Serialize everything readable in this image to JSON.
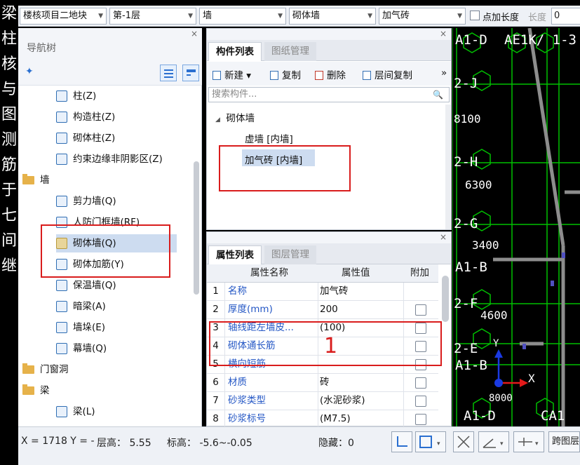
{
  "left_strip": {
    "chars": [
      "梁",
      "柱",
      "核",
      "与",
      "图",
      "测",
      "筋",
      "于",
      "七",
      "间",
      "继"
    ]
  },
  "toolbar": {
    "project": "楼核项目二地块",
    "floor": "第-1层",
    "category": "墙",
    "type": "砌体墙",
    "component": "加气砖",
    "add_length_label": "点加长度",
    "length_label": "长度",
    "length_value": "0"
  },
  "nav": {
    "close": "×",
    "title": "导航树",
    "items": [
      {
        "label": "柱(Z)",
        "kind": "item"
      },
      {
        "label": "构造柱(Z)",
        "kind": "item"
      },
      {
        "label": "砌体柱(Z)",
        "kind": "item"
      },
      {
        "label": "约束边缘非阴影区(Z)",
        "kind": "item"
      },
      {
        "label": "墙",
        "kind": "folder"
      },
      {
        "label": "剪力墙(Q)",
        "kind": "item"
      },
      {
        "label": "人防门框墙(RF)",
        "kind": "item"
      },
      {
        "label": "砌体墙(Q)",
        "kind": "item",
        "selected": true
      },
      {
        "label": "砌体加筋(Y)",
        "kind": "item"
      },
      {
        "label": "保温墙(Q)",
        "kind": "item"
      },
      {
        "label": "暗梁(A)",
        "kind": "item"
      },
      {
        "label": "墙垛(E)",
        "kind": "item"
      },
      {
        "label": "幕墙(Q)",
        "kind": "item"
      },
      {
        "label": "门窗洞",
        "kind": "folder"
      },
      {
        "label": "梁",
        "kind": "folder"
      },
      {
        "label": "梁(L)",
        "kind": "item"
      }
    ]
  },
  "components": {
    "close": "×",
    "tab_active": "构件列表",
    "tab_inactive": "图纸管理",
    "tools": {
      "new": "新建",
      "copy": "复制",
      "delete": "删除",
      "floor_copy": "层间复制",
      "more": "»"
    },
    "search_placeholder": "搜索构件...",
    "group": "砌体墙",
    "items": [
      "虚墙 [内墙]",
      "加气砖 [内墙]"
    ]
  },
  "properties": {
    "close": "×",
    "tab_active": "属性列表",
    "tab_inactive": "图层管理",
    "headers": [
      "属性名称",
      "属性值",
      "附加"
    ],
    "rows": [
      {
        "n": "1",
        "name": "名称",
        "value": "加气砖",
        "check": false
      },
      {
        "n": "2",
        "name": "厚度(mm)",
        "value": "200",
        "check": true
      },
      {
        "n": "3",
        "name": "轴线距左墙皮...",
        "value": "(100)",
        "check": true
      },
      {
        "n": "4",
        "name": "砌体通长筋",
        "value": "",
        "check": true
      },
      {
        "n": "5",
        "name": "横向短筋",
        "value": "",
        "check": true
      },
      {
        "n": "6",
        "name": "材质",
        "value": "砖",
        "check": true
      },
      {
        "n": "7",
        "name": "砂浆类型",
        "value": "(水泥砂浆)",
        "check": true
      },
      {
        "n": "8",
        "name": "砂浆标号",
        "value": "(M7.5)",
        "check": true
      }
    ],
    "annotation": "1"
  },
  "cad": {
    "labels": [
      "A1-D",
      "AE1K/ 1-3",
      "2-J",
      "8100",
      "2-H",
      "6300",
      "2-G",
      "3400",
      "A1-B",
      "2-F",
      "4600",
      "2-E",
      "A1-B",
      "A1-D",
      "CA1",
      "X",
      "Y",
      "8000"
    ],
    "colors": {
      "grid": "#00c000",
      "axis_x": "#e21a1a",
      "axis_y": "#1a3ae2",
      "wall": "#8d8d8d"
    }
  },
  "status": {
    "coords": "X = 1718 Y = -",
    "floor_height": "层高： 5.55",
    "elevation": "标高： -5.6~-0.05",
    "hidden": "隐藏：0",
    "cross_floor": "跨图层"
  }
}
